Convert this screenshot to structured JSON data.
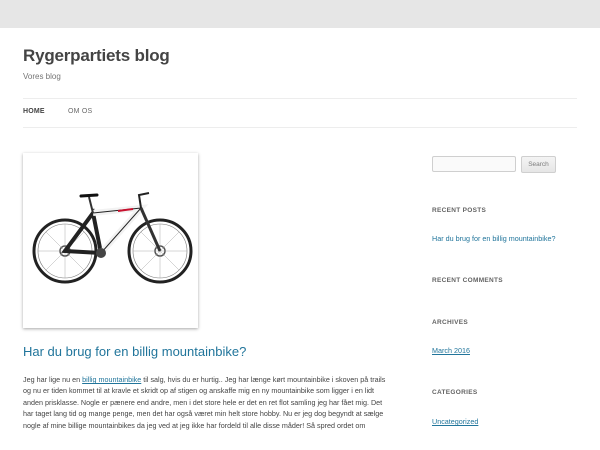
{
  "site": {
    "title": "Rygerpartiets blog",
    "description": "Vores blog"
  },
  "nav": {
    "items": [
      {
        "label": "HOME"
      },
      {
        "label": "OM OS"
      }
    ]
  },
  "post": {
    "title": "Har du brug for en billig mountainbike?",
    "body_before_link": "Jeg har lige nu en ",
    "link_text": "billig mountainbike",
    "body_after_link": " til salg, hvis du er hurtig.. Jeg har længe kørt mountainbike i skoven på trails og nu er tiden kommet til at kravle et skridt op af stigen og anskaffe mig en ny mountainbike som ligger i en lidt anden prisklasse. Nogle er pænere end andre, men i det store hele er det en ret flot samling jeg har fået mig. Det har taget lang tid og mange penge, men det har også været min helt store hobby. Nu er jeg dog begyndt at sælge nogle af mine billige mountainbikes da jeg ved at jeg ikke har fordeld til alle disse måder! Så spred ordet om"
  },
  "sidebar": {
    "search_button": "Search",
    "recent_posts_title": "RECENT POSTS",
    "recent_posts": [
      "Har du brug for en billig mountainbike?"
    ],
    "recent_comments_title": "RECENT COMMENTS",
    "archives_title": "ARCHIVES",
    "archives": [
      "March 2016"
    ],
    "categories_title": "CATEGORIES",
    "categories": [
      "Uncategorized"
    ]
  },
  "colors": {
    "link": "#21759b",
    "background": "#e6e6e6"
  }
}
